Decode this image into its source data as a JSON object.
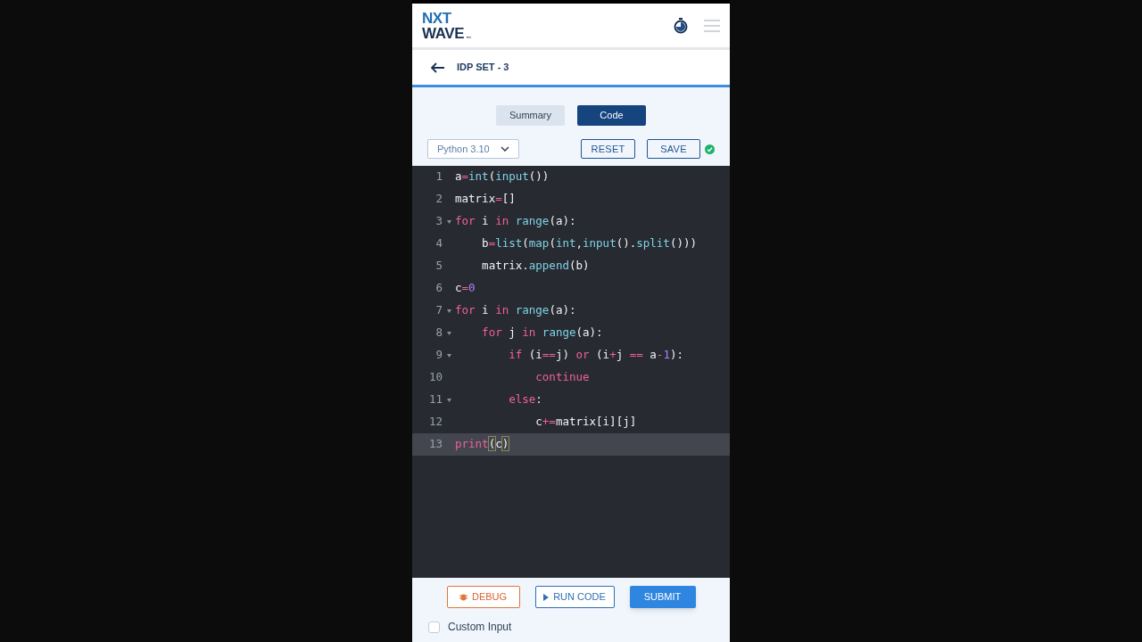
{
  "header": {
    "logo_top": "NXT",
    "logo_bottom": "WAVE",
    "logo_mark": "™"
  },
  "title_bar": {
    "title": "IDP SET - 3"
  },
  "tabs": [
    {
      "label": "Summary",
      "selected": false
    },
    {
      "label": "Code",
      "selected": true
    }
  ],
  "toolbar": {
    "language": "Python 3.10",
    "reset": "RESET",
    "save": "SAVE",
    "saved": true
  },
  "editor": {
    "lines": [
      {
        "number": "1",
        "foldable": false,
        "active": false,
        "tokens": [
          {
            "text": "a",
            "kind": "plain"
          },
          {
            "text": "=",
            "kind": "op"
          },
          {
            "text": "int",
            "kind": "fn"
          },
          {
            "text": "(",
            "kind": "plain"
          },
          {
            "text": "input",
            "kind": "fn"
          },
          {
            "text": "())",
            "kind": "plain"
          }
        ]
      },
      {
        "number": "2",
        "foldable": false,
        "active": false,
        "tokens": [
          {
            "text": "matrix",
            "kind": "plain"
          },
          {
            "text": "=",
            "kind": "op"
          },
          {
            "text": "[]",
            "kind": "plain"
          }
        ]
      },
      {
        "number": "3",
        "foldable": true,
        "active": false,
        "tokens": [
          {
            "text": "for",
            "kind": "kw"
          },
          {
            "text": " i ",
            "kind": "plain"
          },
          {
            "text": "in",
            "kind": "kw"
          },
          {
            "text": " range",
            "kind": "fn"
          },
          {
            "text": "(a):",
            "kind": "plain"
          }
        ]
      },
      {
        "number": "4",
        "foldable": false,
        "active": false,
        "tokens": [
          {
            "text": "    b",
            "kind": "plain"
          },
          {
            "text": "=",
            "kind": "op"
          },
          {
            "text": "list",
            "kind": "fn"
          },
          {
            "text": "(",
            "kind": "plain"
          },
          {
            "text": "map",
            "kind": "fn"
          },
          {
            "text": "(",
            "kind": "plain"
          },
          {
            "text": "int",
            "kind": "fn"
          },
          {
            "text": ",",
            "kind": "plain"
          },
          {
            "text": "input",
            "kind": "fn"
          },
          {
            "text": "().",
            "kind": "plain"
          },
          {
            "text": "split",
            "kind": "fn"
          },
          {
            "text": "()))",
            "kind": "plain"
          }
        ]
      },
      {
        "number": "5",
        "foldable": false,
        "active": false,
        "tokens": [
          {
            "text": "    matrix.",
            "kind": "plain"
          },
          {
            "text": "append",
            "kind": "fn"
          },
          {
            "text": "(b)",
            "kind": "plain"
          }
        ]
      },
      {
        "number": "6",
        "foldable": false,
        "active": false,
        "tokens": [
          {
            "text": "c",
            "kind": "plain"
          },
          {
            "text": "=",
            "kind": "op"
          },
          {
            "text": "0",
            "kind": "num"
          }
        ]
      },
      {
        "number": "7",
        "foldable": true,
        "active": false,
        "tokens": [
          {
            "text": "for",
            "kind": "kw"
          },
          {
            "text": " i ",
            "kind": "plain"
          },
          {
            "text": "in",
            "kind": "kw"
          },
          {
            "text": " range",
            "kind": "fn"
          },
          {
            "text": "(a):",
            "kind": "plain"
          }
        ]
      },
      {
        "number": "8",
        "foldable": true,
        "active": false,
        "tokens": [
          {
            "text": "    for",
            "kind": "kw"
          },
          {
            "text": " j ",
            "kind": "plain"
          },
          {
            "text": "in",
            "kind": "kw"
          },
          {
            "text": " range",
            "kind": "fn"
          },
          {
            "text": "(a):",
            "kind": "plain"
          }
        ]
      },
      {
        "number": "9",
        "foldable": true,
        "active": false,
        "tokens": [
          {
            "text": "        if",
            "kind": "kw"
          },
          {
            "text": " (i",
            "kind": "plain"
          },
          {
            "text": "==",
            "kind": "op"
          },
          {
            "text": "j) ",
            "kind": "plain"
          },
          {
            "text": "or",
            "kind": "kw"
          },
          {
            "text": " (i",
            "kind": "plain"
          },
          {
            "text": "+",
            "kind": "op"
          },
          {
            "text": "j ",
            "kind": "plain"
          },
          {
            "text": "==",
            "kind": "op"
          },
          {
            "text": " a",
            "kind": "plain"
          },
          {
            "text": "-",
            "kind": "op"
          },
          {
            "text": "1",
            "kind": "num"
          },
          {
            "text": "):",
            "kind": "plain"
          }
        ]
      },
      {
        "number": "10",
        "foldable": false,
        "active": false,
        "tokens": [
          {
            "text": "            continue",
            "kind": "kw"
          }
        ]
      },
      {
        "number": "11",
        "foldable": true,
        "active": false,
        "tokens": [
          {
            "text": "        else",
            "kind": "kw"
          },
          {
            "text": ":",
            "kind": "plain"
          }
        ]
      },
      {
        "number": "12",
        "foldable": false,
        "active": false,
        "tokens": [
          {
            "text": "            c",
            "kind": "plain"
          },
          {
            "text": "+=",
            "kind": "op"
          },
          {
            "text": "matrix[i][j]",
            "kind": "plain"
          }
        ]
      },
      {
        "number": "13",
        "foldable": false,
        "active": true,
        "tokens": [
          {
            "text": "print",
            "kind": "kw"
          },
          {
            "text": "(",
            "kind": "bracket"
          },
          {
            "text": "c",
            "kind": "plain"
          },
          {
            "text": ")",
            "kind": "bracket"
          }
        ]
      }
    ]
  },
  "footer": {
    "debug": "DEBUG",
    "run": "RUN CODE",
    "submit": "SUBMIT",
    "custom_input": {
      "label": "Custom Input",
      "checked": false
    }
  }
}
